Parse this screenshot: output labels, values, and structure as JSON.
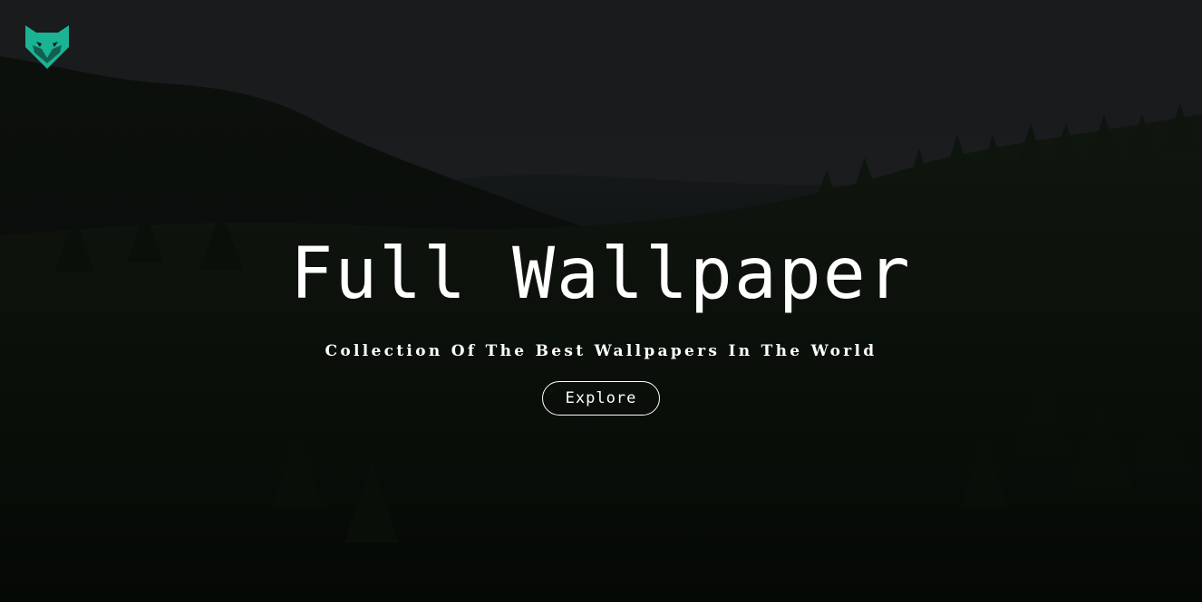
{
  "logo": {
    "icon": "fox-icon",
    "color": "#1ab394"
  },
  "hero": {
    "title": "Full Wallpaper",
    "subtitle": "Collection Of The Best Wallpapers In The World",
    "explore_label": "Explore"
  },
  "colors": {
    "text": "#ffffff",
    "accent": "#1ab394"
  }
}
